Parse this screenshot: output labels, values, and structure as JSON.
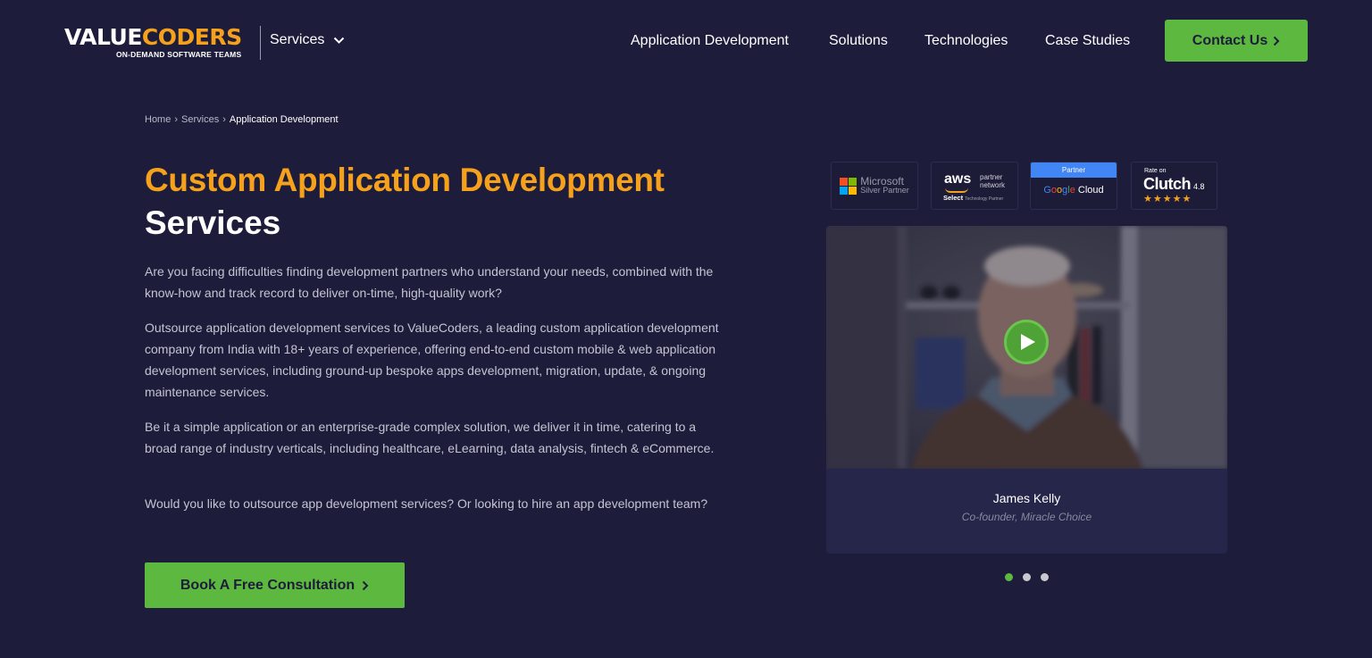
{
  "header": {
    "logo": {
      "part_white": "VALUE",
      "part_orange": "CODERS",
      "tagline": "ON-DEMAND SOFTWARE TEAMS"
    },
    "services_dropdown": "Services",
    "nav": [
      "Application Development",
      "Solutions",
      "Technologies",
      "Case Studies"
    ],
    "contact_label": "Contact Us"
  },
  "breadcrumb": {
    "items": [
      "Home",
      "Services"
    ],
    "current": "Application Development"
  },
  "hero": {
    "title_highlight": "Custom Application Development",
    "title_rest": "Services",
    "paragraphs": [
      "Are you facing difficulties finding development partners who understand your needs, combined with the know-how and track record to deliver on-time, high-quality work?",
      "Outsource application development services to ValueCoders, a leading custom application development company from India with 18+ years of experience, offering end-to-end custom mobile & web application development services, including ground-up bespoke apps development, migration, update, & ongoing maintenance services.",
      "Be it a simple application or an enterprise-grade complex solution, we deliver it in time, catering to a broad range of industry verticals, including healthcare, eLearning, data analysis, fintech & eCommerce.",
      "Would you like to outsource app development services? Or looking to hire an app development team?"
    ],
    "cta_label": "Book A Free Consultation"
  },
  "badges": {
    "microsoft": {
      "line1": "Microsoft",
      "line2": "Silver Partner"
    },
    "aws": {
      "logo": "aws",
      "line1": "partner",
      "line2": "network",
      "select": "Select",
      "tier": "Technology Partner"
    },
    "google": {
      "top": "Partner",
      "g": "G",
      "o1": "o",
      "o2": "o",
      "g2": "g",
      "l": "l",
      "e": "e",
      "cloud": " Cloud"
    },
    "clutch": {
      "rate": "Rate on",
      "name": "Clutch",
      "score": "4.8",
      "stars": "★★★★★"
    }
  },
  "testimonial": {
    "name": "James Kelly",
    "role": "Co-founder, Miracle Choice",
    "slide_count": 3,
    "active_slide": 1
  },
  "colors": {
    "background": "#1d1d3b",
    "accent_orange": "#f6a11c",
    "accent_green": "#5cb83e",
    "card": "#26264a"
  },
  "icons": [
    "chevron-down-icon",
    "chevron-right-icon",
    "play-icon",
    "microsoft-logo-icon"
  ]
}
